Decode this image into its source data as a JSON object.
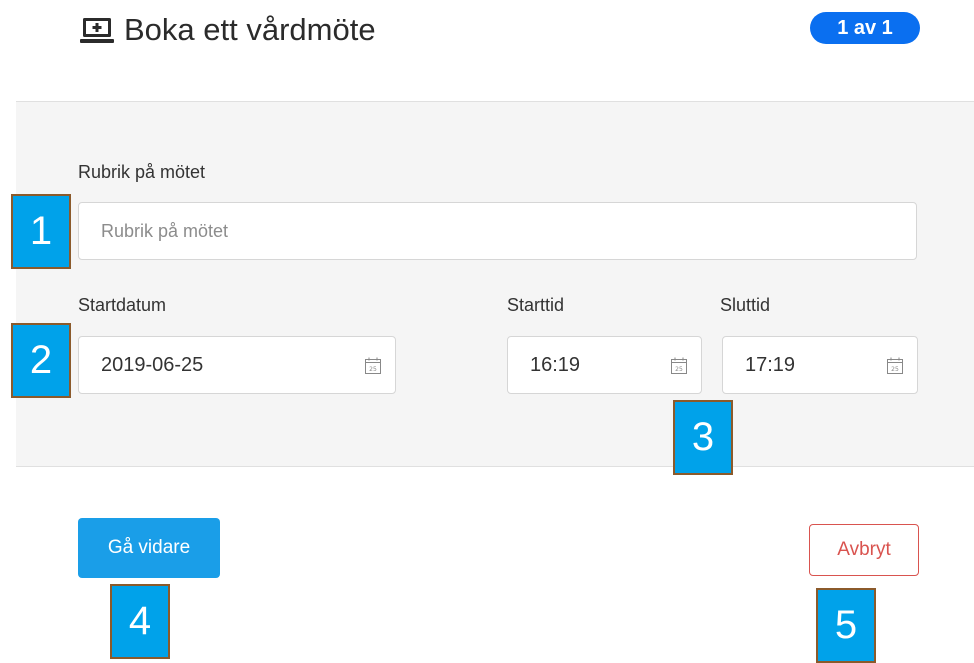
{
  "header": {
    "icon": "monitor-plus-icon",
    "title": "Boka ett vårdmöte",
    "step_badge": "1 av 1"
  },
  "form": {
    "subject": {
      "label": "Rubrik på mötet",
      "placeholder": "Rubrik på mötet",
      "value": ""
    },
    "start_date": {
      "label": "Startdatum",
      "value": "2019-06-25",
      "icon": "calendar-icon"
    },
    "start_time": {
      "label": "Starttid",
      "value": "16:19",
      "icon": "calendar-icon"
    },
    "end_time": {
      "label": "Sluttid",
      "value": "17:19",
      "icon": "calendar-icon"
    },
    "calendar_day": "25"
  },
  "actions": {
    "continue_label": "Gå vidare",
    "cancel_label": "Avbryt"
  },
  "markers": [
    "1",
    "2",
    "3",
    "4",
    "5"
  ],
  "colors": {
    "badge": "#0a6ff0",
    "primary": "#1a9ee8",
    "cancel": "#d9534f",
    "marker": "#00a2ea",
    "marker_border": "#8b5a2b",
    "panel": "#f5f5f5"
  }
}
